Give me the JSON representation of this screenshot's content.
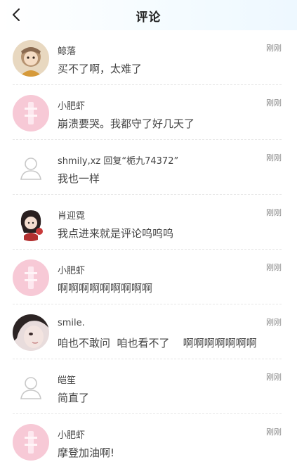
{
  "header": {
    "title": "评论",
    "back_icon": "chevron-left-icon"
  },
  "comments": [
    {
      "name": "鲸落",
      "content": "买不了啊，太难了",
      "time": "刚刚",
      "avatar": "anime-avatar"
    },
    {
      "name": "小肥虾",
      "content": "崩溃要哭。我都守了好几天了",
      "time": "刚刚",
      "avatar": "pink-avatar"
    },
    {
      "name": "shmily,xz 回复“栀九74372”",
      "content": "我也一样",
      "time": "刚刚",
      "avatar": "default-avatar"
    },
    {
      "name": "肖迎霓",
      "content": "我点进来就是评论呜呜呜",
      "time": "刚刚",
      "avatar": "character-avatar"
    },
    {
      "name": "小肥虾",
      "content": "啊啊啊啊啊啊啊啊啊",
      "time": "刚刚",
      "avatar": "pink-avatar"
    },
    {
      "name": "smile.",
      "content": "咱也不敢问  咱也看不了    啊啊啊啊啊啊啊",
      "time": "刚刚",
      "avatar": "photo-avatar"
    },
    {
      "name": "皑笙",
      "content": "简直了",
      "time": "刚刚",
      "avatar": "default-avatar"
    },
    {
      "name": "小肥虾",
      "content": "摩登加油啊!",
      "time": "刚刚",
      "avatar": "pink-avatar"
    }
  ],
  "colors": {
    "pink_avatar_bg": "#f7c9d6",
    "text": "#444444",
    "time": "#888888",
    "divider": "#e6e6e6"
  }
}
